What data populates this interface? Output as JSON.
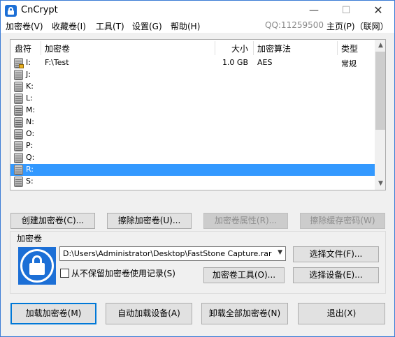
{
  "window": {
    "title": "CnCrypt",
    "minimize": "—",
    "maximize": "☐",
    "close": "✕"
  },
  "menu": {
    "items": [
      "加密卷(V)",
      "收藏卷(I)",
      "工具(T)",
      "设置(G)",
      "帮助(H)"
    ],
    "qq": "QQ:11259500",
    "home": "主页(P)（联网）"
  },
  "table": {
    "headers": [
      "盘符",
      "加密卷",
      "大小",
      "加密算法",
      "类型"
    ],
    "rows": [
      {
        "letter": "I:",
        "volume": "F:\\Test",
        "size": "1.0 GB",
        "algorithm": "AES",
        "type": "常规",
        "mounted": true
      },
      {
        "letter": "J:",
        "volume": "",
        "size": "",
        "algorithm": "",
        "type": "",
        "mounted": false
      },
      {
        "letter": "K:",
        "volume": "",
        "size": "",
        "algorithm": "",
        "type": "",
        "mounted": false
      },
      {
        "letter": "L:",
        "volume": "",
        "size": "",
        "algorithm": "",
        "type": "",
        "mounted": false
      },
      {
        "letter": "M:",
        "volume": "",
        "size": "",
        "algorithm": "",
        "type": "",
        "mounted": false
      },
      {
        "letter": "N:",
        "volume": "",
        "size": "",
        "algorithm": "",
        "type": "",
        "mounted": false
      },
      {
        "letter": "O:",
        "volume": "",
        "size": "",
        "algorithm": "",
        "type": "",
        "mounted": false
      },
      {
        "letter": "P:",
        "volume": "",
        "size": "",
        "algorithm": "",
        "type": "",
        "mounted": false
      },
      {
        "letter": "Q:",
        "volume": "",
        "size": "",
        "algorithm": "",
        "type": "",
        "mounted": false
      },
      {
        "letter": "R:",
        "volume": "",
        "size": "",
        "algorithm": "",
        "type": "",
        "mounted": false,
        "selected": true
      },
      {
        "letter": "S:",
        "volume": "",
        "size": "",
        "algorithm": "",
        "type": "",
        "mounted": false
      }
    ]
  },
  "actions": {
    "create": "创建加密卷(C)...",
    "wipe": "擦除加密卷(U)...",
    "properties": "加密卷属性(R)...",
    "wipe_cache": "擦除缓存密码(W)"
  },
  "volume_group": {
    "label": "加密卷",
    "path": "D:\\Users\\Administrator\\Desktop\\FastStone Capture.rar",
    "select_file": "选择文件(F)...",
    "no_history": "从不保留加密卷使用记录(S)",
    "tools": "加密卷工具(O)...",
    "select_device": "选择设备(E)..."
  },
  "bottom": {
    "mount": "加载加密卷(M)",
    "auto_mount": "自动加载设备(A)",
    "dismount_all": "卸载全部加密卷(N)",
    "exit": "退出(X)"
  },
  "colors": {
    "selection": "#3399ff",
    "accent": "#1c6fd6"
  }
}
